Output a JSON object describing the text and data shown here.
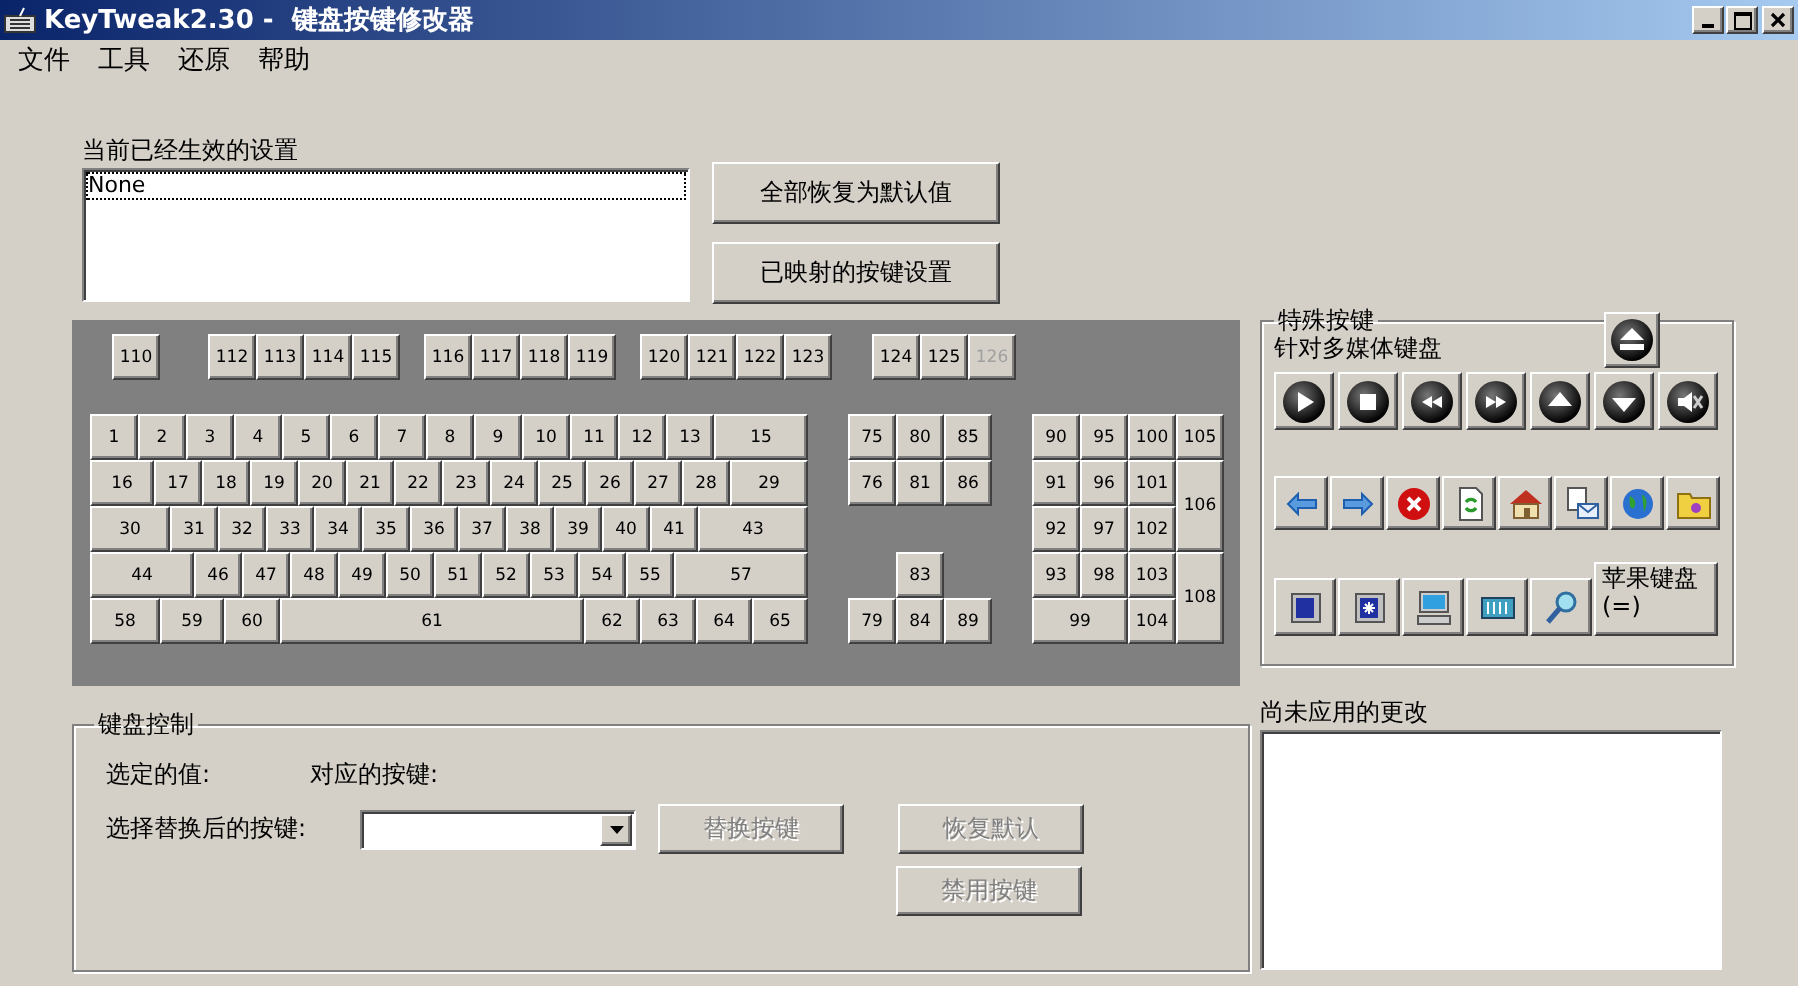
{
  "window": {
    "title": "KeyTweak2.30 -  键盘按键修改器"
  },
  "menu": [
    "文件",
    "工具",
    "还原",
    "帮助"
  ],
  "active_settings": {
    "label": "当前已经生效的设置",
    "items": [
      {
        "text": "None",
        "selected": true
      }
    ]
  },
  "actions": [
    "全部恢复为默认值",
    "已映射的按键设置"
  ],
  "keyboard": {
    "function_groups": [
      [
        {
          "label": "110",
          "disabled": false
        }
      ],
      [
        {
          "label": "112",
          "disabled": false
        },
        {
          "label": "113",
          "disabled": false
        },
        {
          "label": "114",
          "disabled": false
        },
        {
          "label": "115",
          "disabled": false
        }
      ],
      [
        {
          "label": "116",
          "disabled": false
        },
        {
          "label": "117",
          "disabled": false
        },
        {
          "label": "118",
          "disabled": false
        },
        {
          "label": "119",
          "disabled": false
        }
      ],
      [
        {
          "label": "120",
          "disabled": false
        },
        {
          "label": "121",
          "disabled": false
        },
        {
          "label": "122",
          "disabled": false
        },
        {
          "label": "123",
          "disabled": false
        }
      ],
      [
        {
          "label": "124",
          "disabled": false
        },
        {
          "label": "125",
          "disabled": false
        },
        {
          "label": "126",
          "disabled": true
        }
      ]
    ],
    "main_rows": [
      [
        "1",
        "2",
        "3",
        "4",
        "5",
        "6",
        "7",
        "8",
        "9",
        "10",
        "11",
        "12",
        "13",
        "15"
      ],
      [
        "16",
        "17",
        "18",
        "19",
        "20",
        "21",
        "22",
        "23",
        "24",
        "25",
        "26",
        "27",
        "28",
        "29"
      ],
      [
        "30",
        "31",
        "32",
        "33",
        "34",
        "35",
        "36",
        "37",
        "38",
        "39",
        "40",
        "41",
        "43"
      ],
      [
        "44",
        "46",
        "47",
        "48",
        "49",
        "50",
        "51",
        "52",
        "53",
        "54",
        "55",
        "57"
      ],
      [
        "58",
        "59",
        "60",
        "61",
        "62",
        "63",
        "64",
        "65"
      ]
    ],
    "nav_rows": [
      [
        "75",
        "80",
        "85"
      ],
      [
        "76",
        "81",
        "86"
      ],
      [
        "83"
      ],
      [
        "79",
        "84",
        "89"
      ]
    ],
    "numpad": [
      "90",
      "95",
      "100",
      "105",
      "91",
      "96",
      "101",
      "106",
      "92",
      "97",
      "102",
      "93",
      "98",
      "103",
      "108",
      "99",
      "104"
    ]
  },
  "special_keys": {
    "title": "特殊按键",
    "subtitle": "针对多媒体键盘",
    "apple_keyboard": {
      "label": "苹果键盘",
      "note": "(=)"
    }
  },
  "key_control": {
    "title": "键盘控制",
    "selected_value_label": "选定的值:",
    "mapped_key_label": "对应的按键:",
    "replace_label": "选择替换后的按键:",
    "buttons": [
      {
        "label": "替换按键",
        "disabled": true
      },
      {
        "label": "恢复默认",
        "disabled": true
      },
      {
        "label": "禁用按键",
        "disabled": true
      }
    ]
  },
  "pending_changes": {
    "label": "尚未应用的更改"
  }
}
